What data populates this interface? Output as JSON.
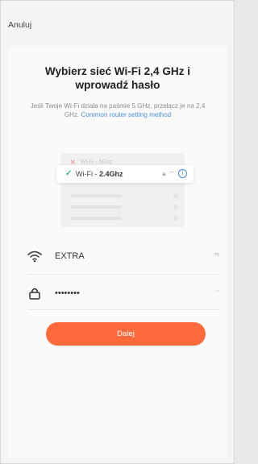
{
  "header": {
    "cancel_label": "Anuluj"
  },
  "main": {
    "title": "Wybierz sieć Wi‑Fi 2,4 GHz i wprowadź hasło",
    "description": "Jeśli Twoje Wi‑Fi działa na paśmie 5 GHz, przełącz je na 2,4 GHz.",
    "link_text": "Common router setting method"
  },
  "wifi_illustration": {
    "bad_network_prefix": "Wi‑Fi - ",
    "bad_network_band": "5Ghz",
    "good_network_prefix": "Wi‑Fi - ",
    "good_network_band": "2.4Ghz"
  },
  "form": {
    "ssid_value": "EXTRA",
    "password_value": "••••••••"
  },
  "action": {
    "next_label": "Dalej"
  },
  "colors": {
    "accent": "#ff6a3d",
    "link": "#4a8fd6",
    "check": "#46b27b"
  },
  "icons": {
    "wifi": "wifi-icon",
    "lock": "lock-icon"
  }
}
